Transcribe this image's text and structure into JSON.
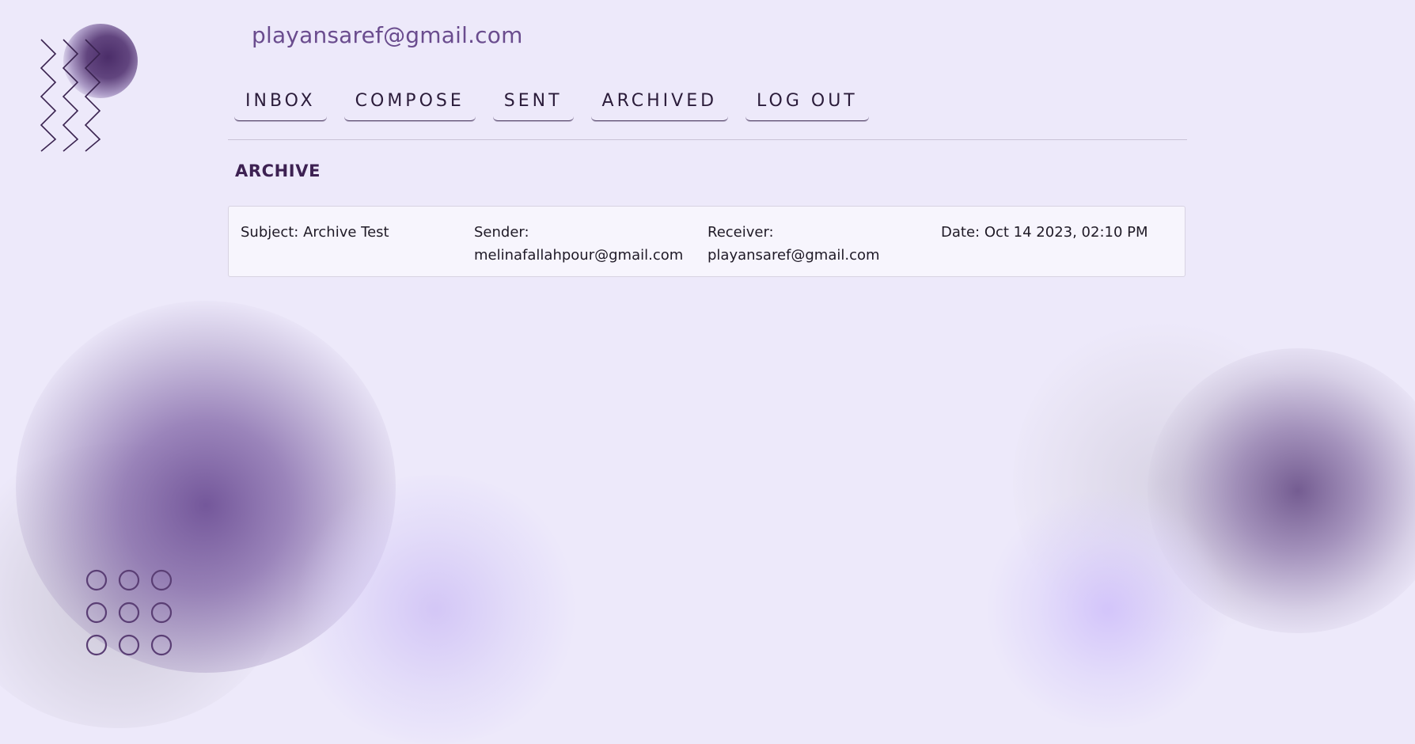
{
  "account": {
    "email": "playansaref@gmail.com"
  },
  "nav": {
    "items": [
      {
        "label": "INBOX"
      },
      {
        "label": "COMPOSE"
      },
      {
        "label": "SENT"
      },
      {
        "label": "ARCHIVED"
      },
      {
        "label": "LOG OUT"
      }
    ]
  },
  "main": {
    "section_title": "ARCHIVE",
    "emails": [
      {
        "subject_label": "Subject:",
        "subject": "Archive Test",
        "sender_label": "Sender:",
        "sender": "melinafallahpour@gmail.com",
        "receiver_label": "Receiver:",
        "receiver": "playansaref@gmail.com",
        "date_label": "Date:",
        "date": "Oct 14 2023, 02:10 PM"
      }
    ]
  },
  "decor": {
    "accent_color": "#6a4c8e",
    "background_color": "#ede9fa",
    "icons": [
      "zigzag-decoration",
      "circle-grid-decoration",
      "orb-decoration"
    ]
  }
}
